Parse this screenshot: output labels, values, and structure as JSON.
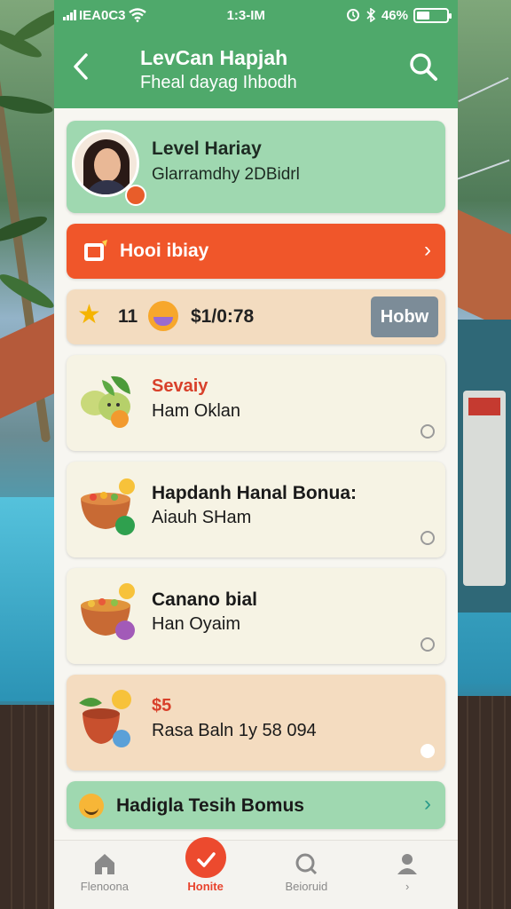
{
  "status_bar": {
    "carrier": "IEA0C3",
    "time": "1:3-IM",
    "battery": "46%"
  },
  "header": {
    "title": "LevCan Hapjah",
    "subtitle": "Fheal dayag Ihbodh"
  },
  "profile": {
    "name": "Level Hariay",
    "meta": "Glarramdhy 2DBidrl"
  },
  "promo": {
    "label": "Hooi ibiay"
  },
  "stats": {
    "count": "11",
    "amount": "$1/0:78",
    "button": "Hobw"
  },
  "items": [
    {
      "title": "Sevaiy",
      "desc": "Ham Oklan"
    },
    {
      "title": "Hapdanh Hanal Bonua:",
      "desc": "Aiauh SHam"
    },
    {
      "title": "Canano bial",
      "desc": "Han Oyaim"
    },
    {
      "title": "$5",
      "desc": "Rasa Baln 1y 58 094"
    }
  ],
  "bonus": {
    "label": "Hadigla Tesih Bomus"
  },
  "tabs": [
    {
      "label": "Flenoona",
      "icon": "home-icon"
    },
    {
      "label": "Honite",
      "icon": "check-icon"
    },
    {
      "label": "Beioruid",
      "icon": "search-icon"
    },
    {
      "label": "›",
      "icon": "user-icon"
    }
  ],
  "colors": {
    "header": "#4fa96b",
    "accent": "#f0562a",
    "mint": "#9fd8b0"
  }
}
